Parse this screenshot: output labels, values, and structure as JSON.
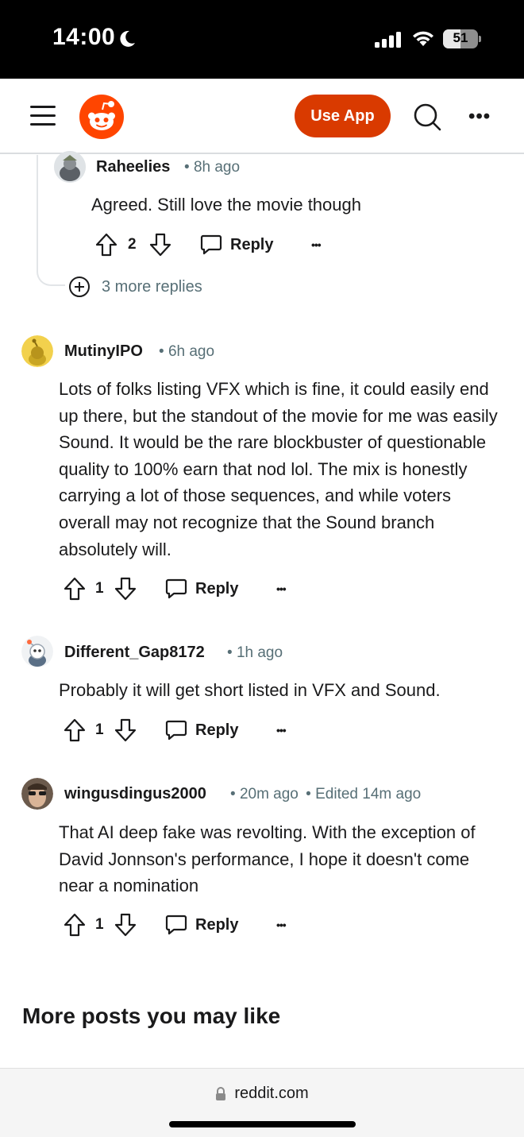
{
  "status_bar": {
    "time": "14:00",
    "battery_level": "51",
    "battery_fraction": 0.51
  },
  "nav": {
    "use_app_label": "Use App",
    "brand_color": "#d93a00"
  },
  "comments": [
    {
      "username": "Raheelies",
      "time": "8h ago",
      "edited": "",
      "body": "Agreed. Still love the movie though",
      "votes": "2",
      "reply_label": "Reply"
    },
    {
      "username": "MutinyIPO",
      "time": "6h ago",
      "edited": "",
      "body": "Lots of folks listing VFX which is fine, it could easily end up there, but the standout of the movie for me was easily Sound. It would be the rare blockbuster of questionable quality to 100% earn that nod lol. The mix is honestly carrying a lot of those sequences, and while voters overall may not recognize that the Sound branch absolutely will.",
      "votes": "1",
      "reply_label": "Reply"
    },
    {
      "username": "Different_Gap8172",
      "time": "1h ago",
      "edited": "",
      "body": "Probably it will get short listed in VFX and Sound.",
      "votes": "1",
      "reply_label": "Reply"
    },
    {
      "username": "wingusdingus2000",
      "time": "20m ago",
      "edited": "Edited 14m ago",
      "body": "That AI deep fake was revolting. With the exception of David Jonnson's performance, I hope it doesn't come near a nomination",
      "votes": "1",
      "reply_label": "Reply"
    }
  ],
  "more_replies_label": "3 more replies",
  "section_title": "More posts you may like",
  "url_bar": {
    "domain": "reddit.com"
  },
  "icons": {
    "more": "•••",
    "dot_sep": "•"
  }
}
